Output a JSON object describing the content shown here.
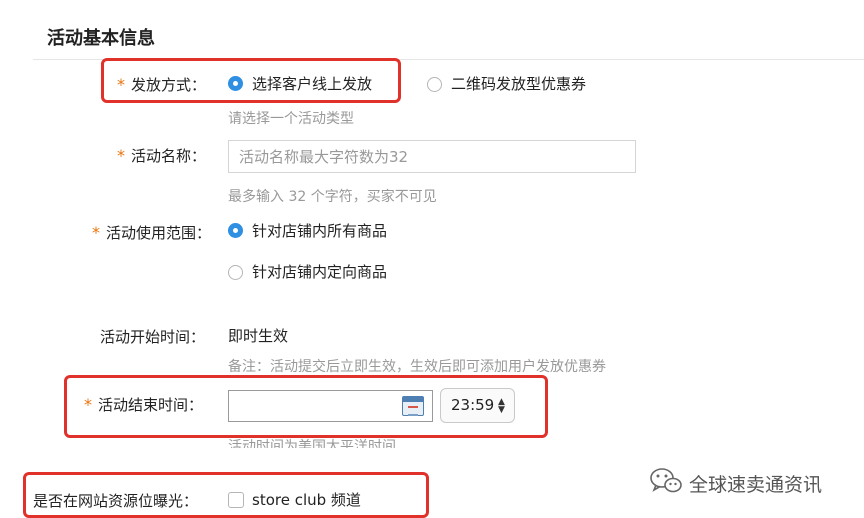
{
  "section": {
    "title": "活动基本信息"
  },
  "form": {
    "required_mark": "*",
    "distribution": {
      "label": "发放方式：",
      "options": [
        {
          "label": "选择客户线上发放",
          "checked": true
        },
        {
          "label": "二维码发放型优惠券",
          "checked": false
        }
      ],
      "hint": "请选择一个活动类型"
    },
    "name": {
      "label": "活动名称：",
      "placeholder": "活动名称最大字符数为32",
      "value": "",
      "hint": "最多输入 32 个字符，买家不可见"
    },
    "scope": {
      "label": "活动使用范围：",
      "options": [
        {
          "label": "针对店铺内所有商品",
          "checked": true
        },
        {
          "label": "针对店铺内定向商品",
          "checked": false
        }
      ]
    },
    "start_time": {
      "label": "活动开始时间：",
      "value": "即时生效",
      "note": "备注：活动提交后立即生效，生效后即可添加用户发放优惠券"
    },
    "end_time": {
      "label": "活动结束时间：",
      "date_value": "",
      "time_value": "23:59",
      "hint": "活动时间为美国太平洋时间"
    },
    "exposure": {
      "label": "是否在网站资源位曝光：",
      "checkbox_label": "store club 频道",
      "checked": false
    }
  },
  "watermark": {
    "text": "全球速卖通资讯",
    "icon": "wechat-icon"
  },
  "colors": {
    "required": "#e8730f",
    "radio_checked": "#2e8fe3",
    "highlight_box": "#e0312b"
  }
}
